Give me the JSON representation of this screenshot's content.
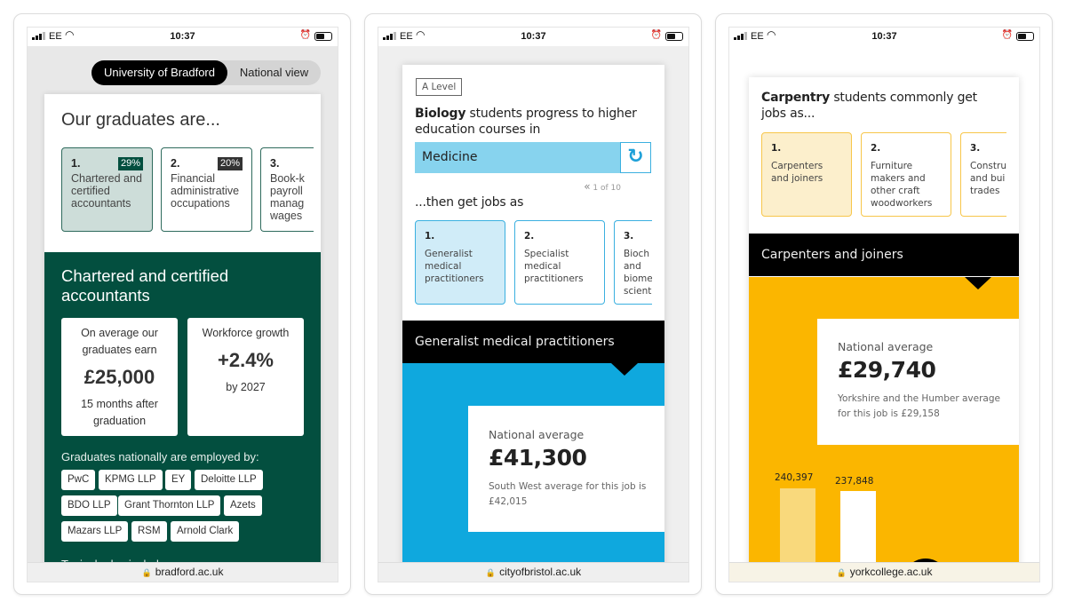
{
  "phones": [
    {
      "status": {
        "carrier": "EE",
        "time": "10:37"
      },
      "toggle": {
        "active": "University of Bradford",
        "inactive": "National view"
      },
      "heading": "Our graduates are...",
      "occupations": [
        {
          "rank": "1.",
          "label": "Chartered and certified accountants",
          "lines": [
            "Chartered and",
            "certified",
            "accountants"
          ],
          "percent": "29%"
        },
        {
          "rank": "2.",
          "label": "Financial administrative occupations",
          "lines": [
            "Financial",
            "administrative",
            "occupations"
          ],
          "percent": "20%"
        },
        {
          "rank": "3.",
          "label": "Book-keepers, payroll managers and wages clerks",
          "lines": [
            "Book-k",
            "payroll",
            "manag",
            "wages"
          ]
        }
      ],
      "detail_title": "Chartered and certified accountants",
      "earnings": {
        "label": "On average our graduates earn",
        "value": "£25,000",
        "note": "15 months after graduation"
      },
      "growth": {
        "label": "Workforce growth",
        "value": "+2.4%",
        "note": "by 2027"
      },
      "employers_label": "Graduates nationally are employed by:",
      "employers": [
        "PwC",
        "KPMG LLP",
        "EY",
        "Deloitte LLP",
        "BDO LLP",
        "Grant Thornton LLP",
        "Azets",
        "Mazars LLP",
        "RSM",
        "Arnold Clark"
      ],
      "roles_label": "Typical roles include:",
      "url": "bradford.ac.uk",
      "colors": {
        "brand": "#034f3f"
      }
    },
    {
      "status": {
        "carrier": "EE",
        "time": "10:37"
      },
      "level_tag": "A Level",
      "subject": "Biology",
      "lead_rest": "students progress to higher education courses in",
      "course": "Medicine",
      "pager": "1 of 10",
      "jobs_label": "...then get jobs as",
      "jobs": [
        {
          "rank": "1.",
          "lines": [
            "Generalist",
            "medical",
            "practitioners"
          ]
        },
        {
          "rank": "2.",
          "lines": [
            "Specialist",
            "medical",
            "practitioners"
          ]
        },
        {
          "rank": "3.",
          "lines": [
            "Bioch",
            "and",
            "biome",
            "scient"
          ]
        }
      ],
      "selected_job": "Generalist medical practitioners",
      "salary": {
        "label": "National average",
        "value": "£41,300",
        "note": "South West average for this job is £42,015"
      },
      "url": "cityofbristol.ac.uk",
      "colors": {
        "brand": "#0fa8de"
      }
    },
    {
      "status": {
        "carrier": "EE",
        "time": "10:37"
      },
      "subject": "Carpentry",
      "lead_rest": "students commonly get jobs as...",
      "jobs": [
        {
          "rank": "1.",
          "lines": [
            "Carpenters",
            "and joiners"
          ]
        },
        {
          "rank": "2.",
          "lines": [
            "Furniture",
            "makers and",
            "other craft",
            "woodworkers"
          ]
        },
        {
          "rank": "3.",
          "lines": [
            "Constru",
            "and bui",
            "trades"
          ]
        }
      ],
      "selected_job": "Carpenters and joiners",
      "salary": {
        "label": "National average",
        "value": "£29,740",
        "note": "Yorkshire and the Humber average for this job is £29,158"
      },
      "bars": [
        {
          "label": "240,397"
        },
        {
          "label": "237,848"
        }
      ],
      "url": "yorkcollege.ac.uk",
      "colors": {
        "brand": "#fbb600"
      }
    }
  ]
}
